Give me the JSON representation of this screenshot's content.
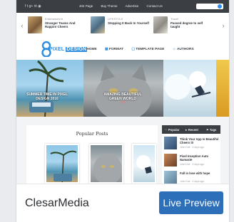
{
  "topbar": {
    "social_icons": [
      "facebook-icon",
      "twitter-icon",
      "google-plus-icon",
      "rss-icon"
    ],
    "social_glyphs": "f  t  g+  ✉  ◉",
    "nav": [
      "404 Page",
      "Buy Theme",
      "Advertise",
      "Contact Us"
    ]
  },
  "ticker": {
    "items": [
      {
        "category": "Entertainment",
        "title": "Stranger Teams And Rappin! Cheers"
      },
      {
        "category": "LIFESTYLE",
        "title": "Stepping It Back In Yourself"
      },
      {
        "category": "Travel",
        "title": "Passed degree to self taught"
      }
    ]
  },
  "brand": {
    "logo_pixel": "PIXEL",
    "logo_design": "DESIGN"
  },
  "mainnav": {
    "items": [
      "HOME",
      "FORMAT",
      "TEMPLATE PAGE",
      "AUTHORS"
    ]
  },
  "slider": {
    "captions": [
      "SUMMER TIME IN PIXEL DESIGN 2016",
      "AMAZING BEAUTIFUL GREEN WORLD",
      ""
    ]
  },
  "popular": {
    "title": "Popular Posts"
  },
  "sidebar": {
    "tabs": [
      "Popular",
      "Recent",
      "Tags"
    ],
    "items": [
      {
        "title": "Think Your App Is Beautiful Cheers it!",
        "meta": "John Doe  ·  4 days ago"
      },
      {
        "title": "Pixel Inception Auto Namaste",
        "meta": "John Doe  ·  4 days ago"
      },
      {
        "title": "Fall in love with hope",
        "meta": "John Doe  ·  4 days ago"
      }
    ]
  },
  "footer": {
    "author": "ClesarMedia",
    "button": "Live Preview"
  },
  "colors": {
    "accent": "#2f8de0",
    "button": "#2d6fb8",
    "dark_bar": "#3b3e42"
  }
}
